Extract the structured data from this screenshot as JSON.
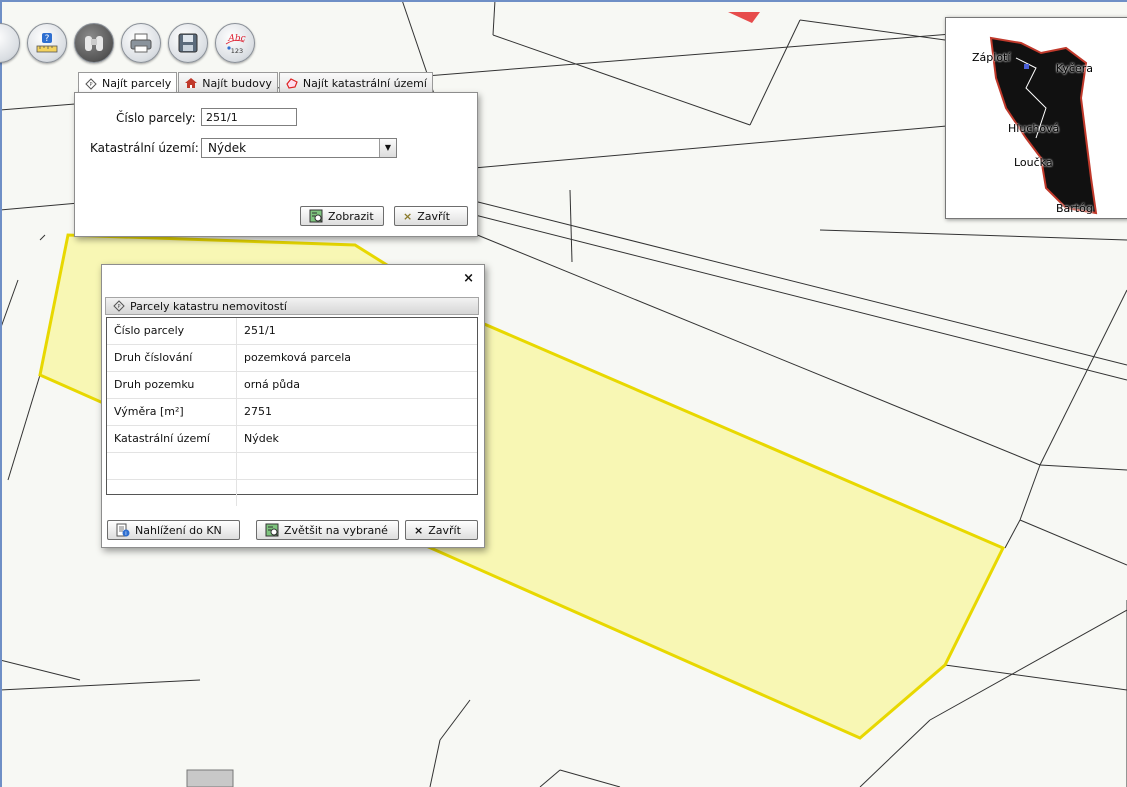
{
  "toolbar": {
    "buttons": [
      {
        "icon": "help-ruler-icon"
      },
      {
        "icon": "binoculars-icon"
      },
      {
        "icon": "print-icon"
      },
      {
        "icon": "save-icon"
      },
      {
        "icon": "abc-label-icon",
        "text_top": "Abc",
        "text_bottom": "123"
      }
    ]
  },
  "find": {
    "tabs": [
      {
        "label": "Najít parcely",
        "icon": "parcel-icon",
        "active": true
      },
      {
        "label": "Najít budovy",
        "icon": "house-icon",
        "active": false
      },
      {
        "label": "Najít katastrální území",
        "icon": "area-icon",
        "active": false
      }
    ],
    "parcel_label": "Číslo parcely:",
    "parcel_value": "251/1",
    "area_label": "Katastrální území:",
    "area_value": "Nýdek",
    "show_label": "Zobrazit",
    "close_label": "Zavřít"
  },
  "info": {
    "title": "Parcely katastru nemovitostí",
    "close_glyph": "×",
    "rows": [
      {
        "label": "Číslo parcely",
        "value": "251/1"
      },
      {
        "label": "Druh číslování",
        "value": "pozemková parcela"
      },
      {
        "label": "Druh pozemku",
        "value": "orná půda"
      },
      {
        "label": "Výměra [m²]",
        "value": "2751"
      },
      {
        "label": "Katastrální území",
        "value": "Nýdek"
      }
    ],
    "btn_view_kn": "Nahlížení do KN",
    "btn_zoom": "Zvětšit na vybrané",
    "btn_close": "Zavřít"
  },
  "overview": {
    "places": [
      "Záplotí",
      "Kyčera",
      "Hluchová",
      "Loučka",
      "Bartóg"
    ]
  },
  "colors": {
    "parcel_fill": "#f8f7b4",
    "parcel_stroke": "#e8d800",
    "frame": "#6f8fc6"
  }
}
